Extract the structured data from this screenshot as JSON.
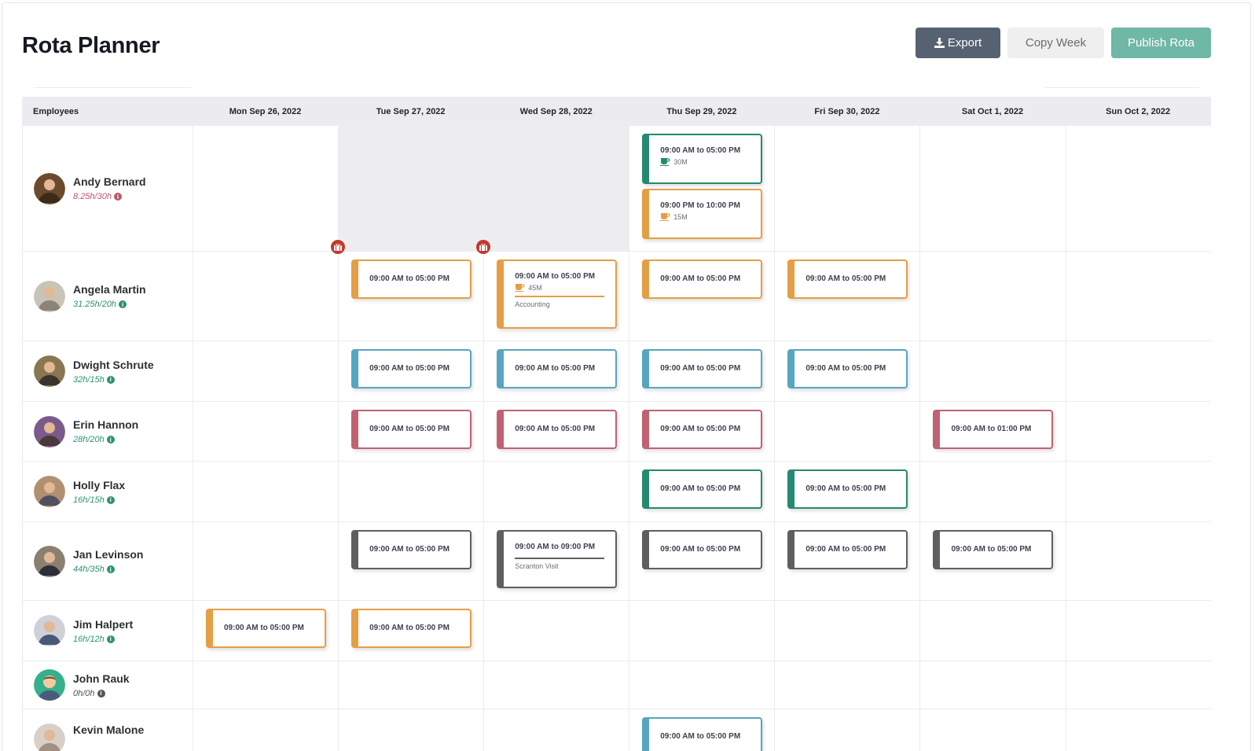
{
  "page": {
    "title": "Rota Planner"
  },
  "toolbar": {
    "export_label": "Export",
    "copy_week_label": "Copy Week",
    "publish_label": "Publish Rota"
  },
  "colors": {
    "orange": "#e49f46",
    "green": "#258a6f",
    "blue": "#57a6bf",
    "red": "#c06272",
    "grey": "#5f5f5f",
    "hours_over": "#2e9270",
    "hours_under": "#c0566a",
    "hours_zero": "#555555",
    "leave_badge": "#c0392b",
    "primary_button": "#566271",
    "publish_button": "#6fb7a6"
  },
  "table": {
    "employees_header": "Employees",
    "days": [
      "Mon Sep 26, 2022",
      "Tue Sep 27, 2022",
      "Wed Sep 28, 2022",
      "Thu Sep 29, 2022",
      "Fri Sep 30, 2022",
      "Sat Oct 1, 2022",
      "Sun Oct 2, 2022"
    ]
  },
  "employees": [
    {
      "name": "Andy Bernard",
      "hours": "8.25h/30h",
      "hours_status": "under",
      "avatar": "photo",
      "unavailable_days": [
        1,
        2
      ],
      "shifts": [
        {
          "day": 3,
          "time": "09:00 AM to 05:00 PM",
          "break": "30M",
          "color": "green"
        },
        {
          "day": 3,
          "time": "09:00 PM to 10:00 PM",
          "break": "15M",
          "color": "orange"
        }
      ]
    },
    {
      "name": "Angela Martin",
      "hours": "31.25h/20h",
      "hours_status": "over",
      "avatar": "photo",
      "leave_badges": [
        1,
        2
      ],
      "shifts": [
        {
          "day": 1,
          "time": "09:00 AM to 05:00 PM",
          "color": "orange"
        },
        {
          "day": 2,
          "time": "09:00 AM to 05:00 PM",
          "break": "45M",
          "note": "Accounting",
          "color": "orange"
        },
        {
          "day": 3,
          "time": "09:00 AM to 05:00 PM",
          "color": "orange"
        },
        {
          "day": 4,
          "time": "09:00 AM to 05:00 PM",
          "color": "orange"
        }
      ]
    },
    {
      "name": "Dwight Schrute",
      "hours": "32h/15h",
      "hours_status": "over",
      "avatar": "photo",
      "shifts": [
        {
          "day": 1,
          "time": "09:00 AM to 05:00 PM",
          "color": "blue"
        },
        {
          "day": 2,
          "time": "09:00 AM to 05:00 PM",
          "color": "blue"
        },
        {
          "day": 3,
          "time": "09:00 AM to 05:00 PM",
          "color": "blue"
        },
        {
          "day": 4,
          "time": "09:00 AM to 05:00 PM",
          "color": "blue"
        }
      ]
    },
    {
      "name": "Erin Hannon",
      "hours": "28h/20h",
      "hours_status": "over",
      "avatar": "photo",
      "shifts": [
        {
          "day": 1,
          "time": "09:00 AM to 05:00 PM",
          "color": "red"
        },
        {
          "day": 2,
          "time": "09:00 AM to 05:00 PM",
          "color": "red"
        },
        {
          "day": 3,
          "time": "09:00 AM to 05:00 PM",
          "color": "red"
        },
        {
          "day": 5,
          "time": "09:00 AM to 01:00 PM",
          "color": "red"
        }
      ]
    },
    {
      "name": "Holly Flax",
      "hours": "16h/15h",
      "hours_status": "over",
      "avatar": "photo",
      "shifts": [
        {
          "day": 3,
          "time": "09:00 AM to 05:00 PM",
          "color": "green"
        },
        {
          "day": 4,
          "time": "09:00 AM to 05:00 PM",
          "color": "green"
        }
      ]
    },
    {
      "name": "Jan Levinson",
      "hours": "44h/35h",
      "hours_status": "over",
      "avatar": "photo",
      "shifts": [
        {
          "day": 1,
          "time": "09:00 AM to 05:00 PM",
          "color": "grey"
        },
        {
          "day": 2,
          "time": "09:00 AM to 09:00 PM",
          "note": "Scranton Visit",
          "color": "grey"
        },
        {
          "day": 3,
          "time": "09:00 AM to 05:00 PM",
          "color": "grey"
        },
        {
          "day": 4,
          "time": "09:00 AM to 05:00 PM",
          "color": "grey"
        },
        {
          "day": 5,
          "time": "09:00 AM to 05:00 PM",
          "color": "grey"
        }
      ]
    },
    {
      "name": "Jim Halpert",
      "hours": "16h/12h",
      "hours_status": "over",
      "avatar": "photo",
      "shifts": [
        {
          "day": 0,
          "time": "09:00 AM to 05:00 PM",
          "color": "orange"
        },
        {
          "day": 1,
          "time": "09:00 AM to 05:00 PM",
          "color": "orange"
        }
      ]
    },
    {
      "name": "John Rauk",
      "hours": "0h/0h",
      "hours_status": "zero",
      "avatar": "placeholder",
      "shifts": []
    },
    {
      "name": "Kevin Malone",
      "hours": "",
      "hours_status": "over",
      "avatar": "photo",
      "shifts": [
        {
          "day": 3,
          "time": "09:00 AM to 05:00 PM",
          "color": "blue"
        }
      ]
    }
  ]
}
